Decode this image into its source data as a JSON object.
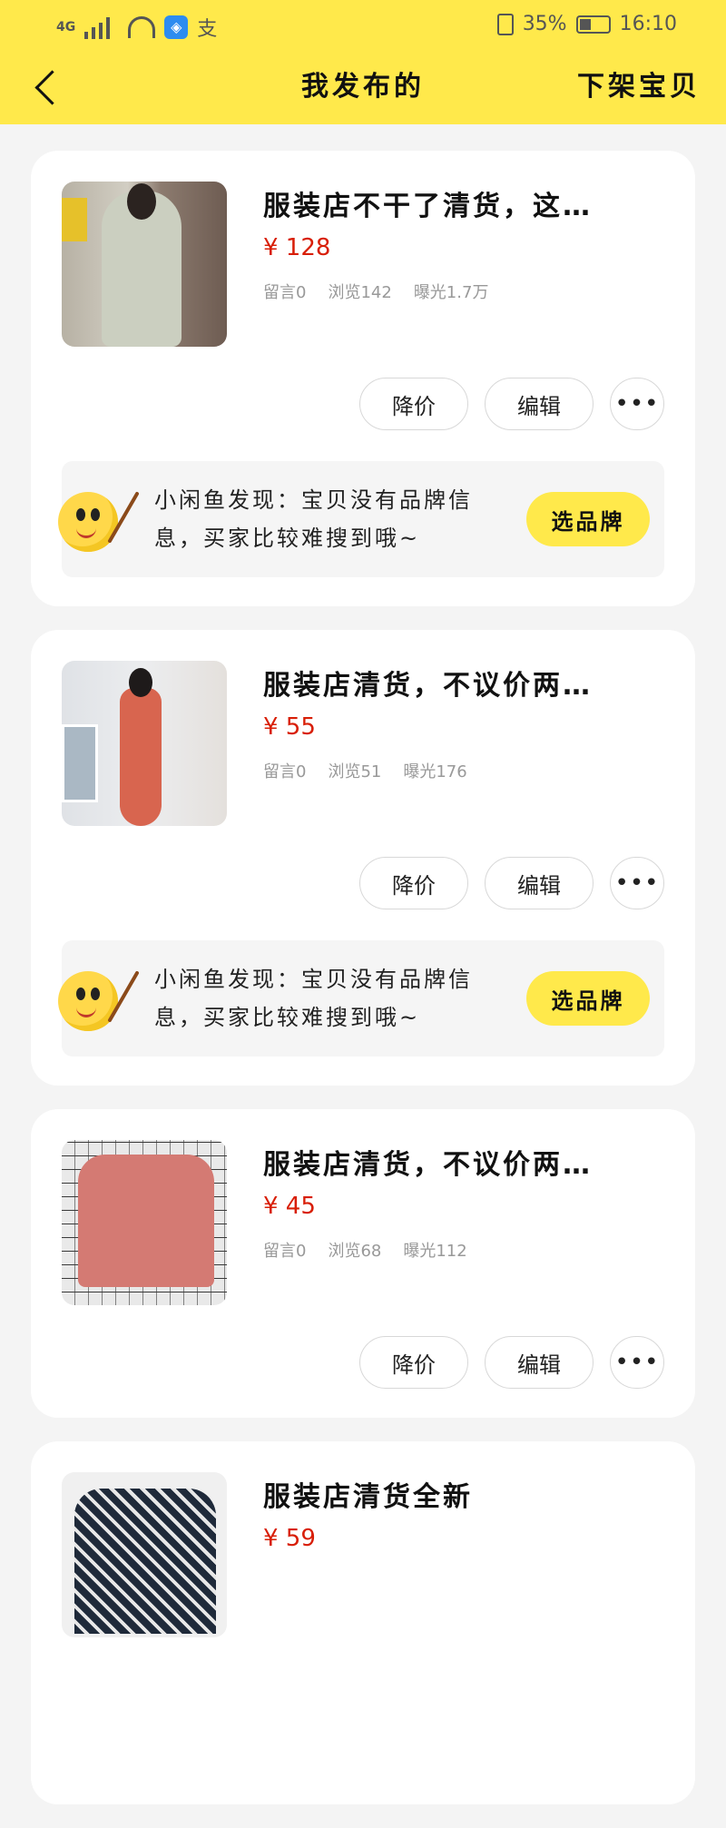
{
  "status_bar": {
    "network": "4G",
    "battery": "35%",
    "time": "16:10",
    "alipay_glyph": "支"
  },
  "header": {
    "title": "我发布的",
    "right_action": "下架宝贝",
    "back_icon": "chevron-left-icon"
  },
  "listings": [
    {
      "title": "服装店不干了清货，这…",
      "price": "¥ 128",
      "stats": [
        "留言0",
        "浏览142",
        "曝光1.7万"
      ],
      "actions": [
        "降价",
        "编辑",
        "•••"
      ],
      "tip": {
        "text": "小闲鱼发现：宝贝没有品牌信息，买家比较难搜到哦~",
        "button": "选品牌"
      }
    },
    {
      "title": "服装店清货，不议价两…",
      "price": "¥ 55",
      "stats": [
        "留言0",
        "浏览51",
        "曝光176"
      ],
      "actions": [
        "降价",
        "编辑",
        "•••"
      ],
      "tip": {
        "text": "小闲鱼发现：宝贝没有品牌信息，买家比较难搜到哦~",
        "button": "选品牌"
      }
    },
    {
      "title": "服装店清货，不议价两…",
      "price": "¥ 45",
      "stats": [
        "留言0",
        "浏览68",
        "曝光112"
      ],
      "actions": [
        "降价",
        "编辑",
        "•••"
      ]
    },
    {
      "title": "服装店清货全新",
      "price": "¥ 59"
    }
  ]
}
